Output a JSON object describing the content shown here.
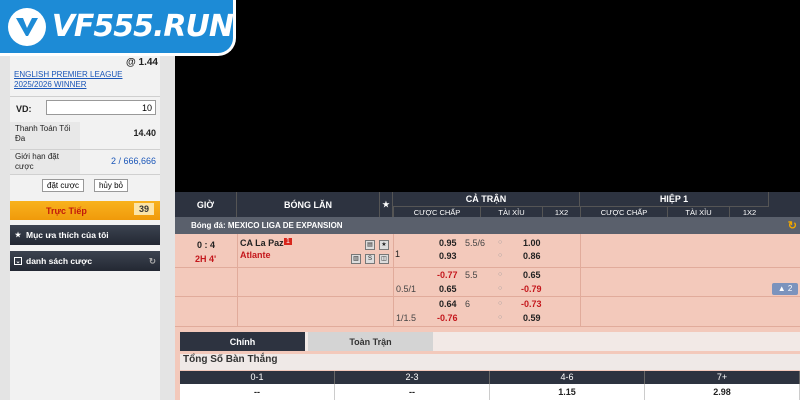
{
  "brand": {
    "logo_text": "VF555.RUN"
  },
  "betslip": {
    "odds": "@ 1.44",
    "league": "ENGLISH PREMIER LEAGUE 2025/2026 WINNER",
    "vd_label": "VD:",
    "vd_value": "10",
    "max_payout_label": "Thanh Toán Tối Đa",
    "max_payout_value": "14.40",
    "limit_label": "Giới hạn đặt cược",
    "limit_value": "2 / 666,666",
    "place_bet": "đặt cược",
    "cancel": "hủy bỏ"
  },
  "live": {
    "label": "Trực Tiếp",
    "count": "39"
  },
  "menu": {
    "favorites": "Mục ưa thích của tôi",
    "bet_list": "danh sách cược"
  },
  "table": {
    "headers": {
      "time": "GIỜ",
      "match": "BÓNG LĂN",
      "full": "CẢ TRẬN",
      "half": "HIỆP 1"
    },
    "subheaders": [
      "CƯỢC CHẤP",
      "TÀI XỈU",
      "1X2",
      "CƯỢC CHẤP",
      "TÀI XỈU",
      "1X2"
    ],
    "league": "Bóng đá: MEXICO LIGA DE EXPANSION",
    "match": {
      "score": "0 : 4",
      "period": "2H 4'",
      "home": "CA La Paz",
      "away": "Atlante",
      "home_red_card": "1",
      "draw": "1",
      "expand": "▲ 2",
      "lines": [
        {
          "hdp": "",
          "hdp_home": "0.95",
          "hdp_away": "0.93",
          "ou": "5.5/6",
          "ou_over": "1.00",
          "ou_under": "0.86"
        },
        {
          "hdp": "0.5/1",
          "hdp_home": "-0.77",
          "hdp_away": "0.65",
          "ou": "5.5",
          "ou_over": "0.65",
          "ou_under": "-0.79"
        },
        {
          "hdp": "1/1.5",
          "hdp_home": "0.64",
          "hdp_away": "-0.76",
          "ou": "6",
          "ou_over": "-0.73",
          "ou_under": "0.59"
        }
      ]
    }
  },
  "tabs": [
    "Chính",
    "Toàn Trận"
  ],
  "totals": {
    "title": "Tổng Số Bàn Thắng",
    "headers": [
      "0-1",
      "2-3",
      "4-6",
      "7+"
    ],
    "values": [
      "--",
      "--",
      "1.15",
      "2.98"
    ]
  }
}
